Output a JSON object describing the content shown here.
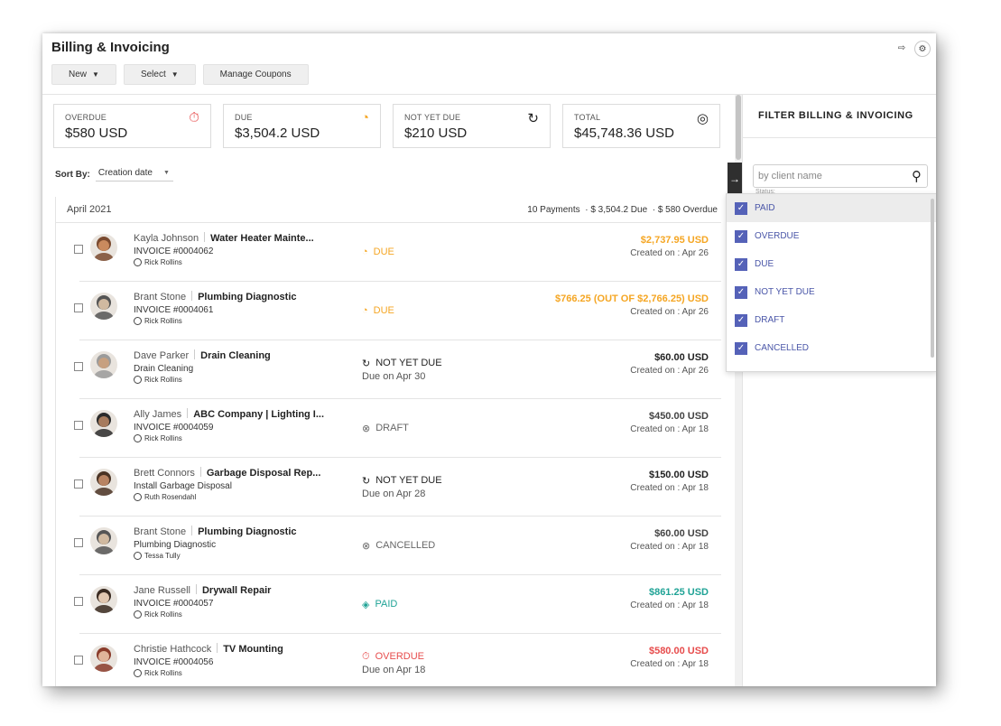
{
  "app": {
    "title": "Billing & Invoicing"
  },
  "toolbar": {
    "new_label": "New",
    "select_label": "Select",
    "coupons_label": "Manage Coupons"
  },
  "summary": [
    {
      "label": "OVERDUE",
      "value": "$580 USD",
      "icon": "stopwatch-icon",
      "color": "#e74c4c"
    },
    {
      "label": "DUE",
      "value": "$3,504.2 USD",
      "icon": "clock-due-icon",
      "color": "#f5a623"
    },
    {
      "label": "NOT YET DUE",
      "value": "$210 USD",
      "icon": "clock-rewind-icon",
      "color": "#222222"
    },
    {
      "label": "TOTAL",
      "value": "$45,748.36 USD",
      "icon": "coins-stack-icon",
      "color": "#222222"
    }
  ],
  "sort": {
    "label": "Sort By:",
    "value": "Creation date"
  },
  "group": {
    "name": "April 2021",
    "payments": "10 Payments",
    "due": "$ 3,504.2 Due",
    "overdue": "$ 580 Overdue"
  },
  "invoices": [
    {
      "client": "Kayla Johnson",
      "job": "Water Heater Mainte...",
      "subtitle": "INVOICE #0004062",
      "assignee": "Rick Rollins",
      "status": "DUE",
      "status_kind": "due",
      "status_sub": "",
      "amount": "$2,737.95 USD",
      "amount_kind": "due",
      "created": "Created on : Apr 26"
    },
    {
      "client": "Brant Stone",
      "job": "Plumbing Diagnostic",
      "subtitle": "INVOICE #0004061",
      "assignee": "Rick Rollins",
      "status": "DUE",
      "status_kind": "due",
      "status_sub": "",
      "amount": "$766.25 (OUT OF $2,766.25) USD",
      "amount_kind": "due",
      "created": "Created on : Apr 26"
    },
    {
      "client": "Dave Parker",
      "job": "Drain Cleaning",
      "subtitle": "Drain Cleaning",
      "assignee": "Rick Rollins",
      "status": "NOT YET DUE",
      "status_kind": "notyet",
      "status_sub": "Due on Apr 30",
      "amount": "$60.00 USD",
      "amount_kind": "dark",
      "created": "Created on : Apr 26"
    },
    {
      "client": "Ally James",
      "job": "ABC Company | Lighting I...",
      "subtitle": "INVOICE #0004059",
      "assignee": "Rick Rollins",
      "status": "DRAFT",
      "status_kind": "draft",
      "status_sub": "",
      "amount": "$450.00 USD",
      "amount_kind": "gray",
      "created": "Created on : Apr 18"
    },
    {
      "client": "Brett Connors",
      "job": "Garbage Disposal Rep...",
      "subtitle": "Install Garbage Disposal",
      "assignee": "Ruth Rosendahl",
      "status": "NOT YET DUE",
      "status_kind": "notyet",
      "status_sub": "Due on Apr 28",
      "amount": "$150.00 USD",
      "amount_kind": "dark",
      "created": "Created on : Apr 18"
    },
    {
      "client": "Brant Stone",
      "job": "Plumbing Diagnostic",
      "subtitle": "Plumbing Diagnostic",
      "assignee": "Tessa Tully",
      "status": "CANCELLED",
      "status_kind": "draft",
      "status_sub": "",
      "amount": "$60.00 USD",
      "amount_kind": "gray",
      "created": "Created on : Apr 18"
    },
    {
      "client": "Jane Russell",
      "job": "Drywall Repair",
      "subtitle": "INVOICE #0004057",
      "assignee": "Rick Rollins",
      "status": "PAID",
      "status_kind": "paid",
      "status_sub": "",
      "amount": "$861.25 USD",
      "amount_kind": "paid",
      "created": "Created on : Apr 18"
    },
    {
      "client": "Christie Hathcock",
      "job": "TV Mounting",
      "subtitle": "INVOICE #0004056",
      "assignee": "Rick Rollins",
      "status": "OVERDUE",
      "status_kind": "overdue",
      "status_sub": "Due on Apr 18",
      "amount": "$580.00 USD",
      "amount_kind": "overdue",
      "created": "Created on : Apr 18"
    }
  ],
  "filter_panel": {
    "title": "FILTER BILLING & INVOICING",
    "search_placeholder": "by client name",
    "status_hint": "Status:",
    "options": [
      {
        "label": "PAID",
        "checked": true
      },
      {
        "label": "OVERDUE",
        "checked": true
      },
      {
        "label": "DUE",
        "checked": true
      },
      {
        "label": "NOT YET DUE",
        "checked": true
      },
      {
        "label": "DRAFT",
        "checked": true
      },
      {
        "label": "CANCELLED",
        "checked": true
      }
    ]
  },
  "colors": {
    "due": "#f5a623",
    "paid": "#20a396",
    "overdue": "#e74c4c",
    "accent": "#5562b8"
  }
}
